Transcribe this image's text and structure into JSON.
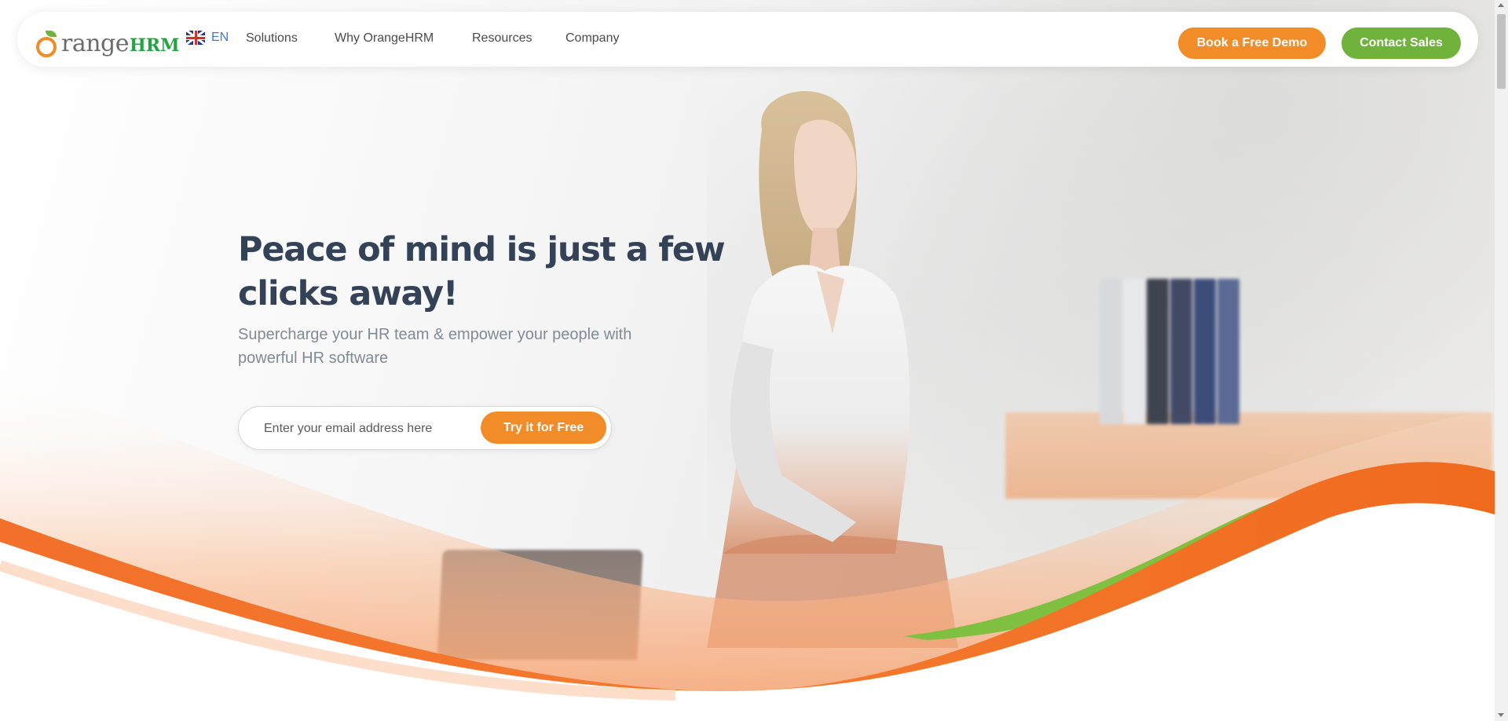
{
  "brand": {
    "logo_text_main": "range",
    "logo_text_suffix": "HRM",
    "colors": {
      "orange": "#f28c28",
      "green": "#6fb33d",
      "title": "#344257"
    }
  },
  "nav": {
    "language": {
      "icon": "uk-flag-icon",
      "label": "EN"
    },
    "items": [
      "Solutions",
      "Why OrangeHRM",
      "Resources",
      "Company"
    ],
    "book_demo_label": "Book a Free Demo",
    "contact_sales_label": "Contact Sales"
  },
  "hero": {
    "title": "Peace of mind is just a few clicks away!",
    "subtitle": "Supercharge your HR team & empower your people with powerful HR software",
    "email_placeholder": "Enter your email address here",
    "try_label": "Try it for Free"
  }
}
